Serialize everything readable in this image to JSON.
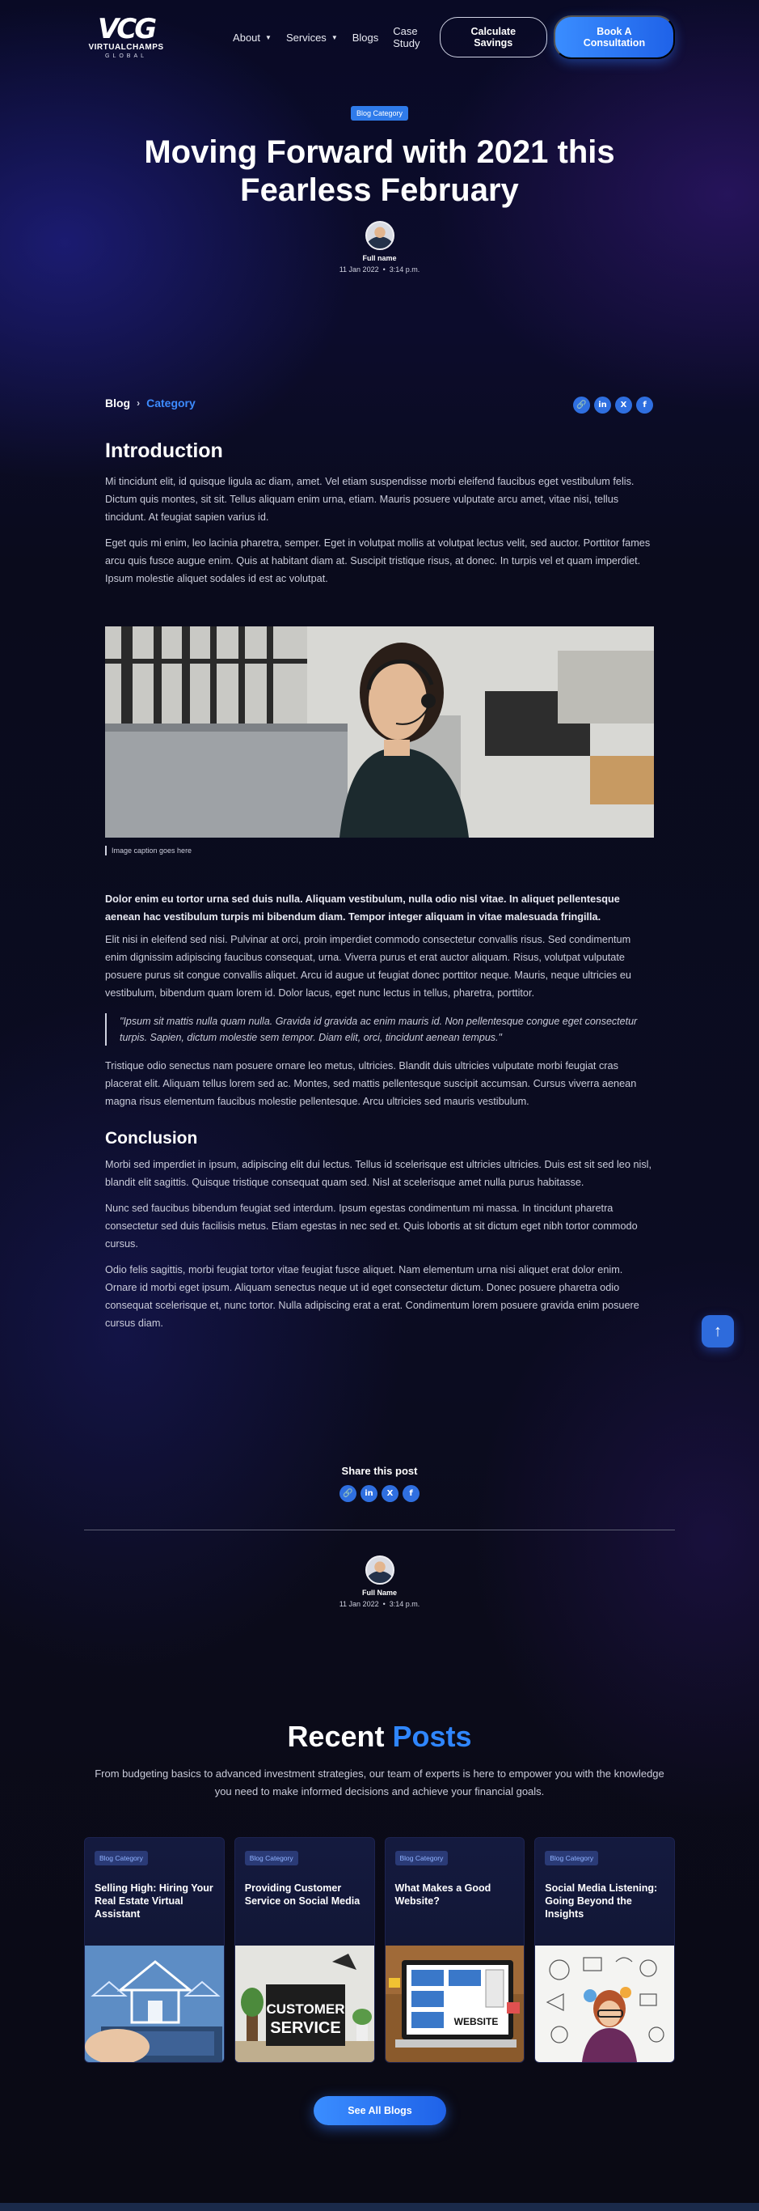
{
  "brand": {
    "logo_mark": "VCG",
    "name": "VIRTUALCHAMPS",
    "sub": "GLOBAL"
  },
  "nav": {
    "items": [
      {
        "label": "About",
        "has_menu": true
      },
      {
        "label": "Services",
        "has_menu": true
      },
      {
        "label": "Blogs",
        "has_menu": false
      },
      {
        "label": "Case Study",
        "has_menu": false
      }
    ],
    "calc_label": "Calculate Savings",
    "book_label": "Book A Consultation"
  },
  "hero": {
    "badge": "Blog Category",
    "title": "Moving Forward with 2021 this Fearless February",
    "author": "Full name",
    "date": "11 Jan 2022",
    "time": "3:14 p.m."
  },
  "breadcrumb": {
    "root": "Blog",
    "current": "Category"
  },
  "share_icons": [
    "link-icon",
    "linkedin-icon",
    "x-icon",
    "facebook-icon"
  ],
  "article": {
    "intro_heading": "Introduction",
    "intro_p1": "Mi tincidunt elit, id quisque ligula ac diam, amet. Vel etiam suspendisse morbi eleifend faucibus eget vestibulum felis. Dictum quis montes, sit sit. Tellus aliquam enim urna, etiam. Mauris posuere vulputate arcu amet, vitae nisi, tellus tincidunt. At feugiat sapien varius id.",
    "intro_p2": "Eget quis mi enim, leo lacinia pharetra, semper. Eget in volutpat mollis at volutpat lectus velit, sed auctor. Porttitor fames arcu quis fusce augue enim. Quis at habitant diam at. Suscipit tristique risus, at donec. In turpis vel et quam imperdiet. Ipsum molestie aliquet sodales id est ac volutpat.",
    "image_caption": "Image caption goes here",
    "lead": "Dolor enim eu tortor urna sed duis nulla. Aliquam vestibulum, nulla odio nisl vitae. In aliquet pellentesque aenean hac vestibulum turpis mi bibendum diam. Tempor integer aliquam in vitae malesuada fringilla.",
    "body_p1": "Elit nisi in eleifend sed nisi. Pulvinar at orci, proin imperdiet commodo consectetur convallis risus. Sed condimentum enim dignissim adipiscing faucibus consequat, urna. Viverra purus et erat auctor aliquam. Risus, volutpat vulputate posuere purus sit congue convallis aliquet. Arcu id augue ut feugiat donec porttitor neque. Mauris, neque ultricies eu vestibulum, bibendum quam lorem id. Dolor lacus, eget nunc lectus in tellus, pharetra, porttitor.",
    "quote": "\"Ipsum sit mattis nulla quam nulla. Gravida id gravida ac enim mauris id. Non pellentesque congue eget consectetur turpis. Sapien, dictum molestie sem tempor. Diam elit, orci, tincidunt aenean tempus.\"",
    "body_p2": "Tristique odio senectus nam posuere ornare leo metus, ultricies. Blandit duis ultricies vulputate morbi feugiat cras placerat elit. Aliquam tellus lorem sed ac. Montes, sed mattis pellentesque suscipit accumsan. Cursus viverra aenean magna risus elementum faucibus molestie pellentesque. Arcu ultricies sed mauris vestibulum.",
    "conclusion_heading": "Conclusion",
    "concl_p1": "Morbi sed imperdiet in ipsum, adipiscing elit dui lectus. Tellus id scelerisque est ultricies ultricies. Duis est sit sed leo nisl, blandit elit sagittis. Quisque tristique consequat quam sed. Nisl at scelerisque amet nulla purus habitasse.",
    "concl_p2": "Nunc sed faucibus bibendum feugiat sed interdum. Ipsum egestas condimentum mi massa. In tincidunt pharetra consectetur sed duis facilisis metus. Etiam egestas in nec sed et. Quis lobortis at sit dictum eget nibh tortor commodo cursus.",
    "concl_p3": "Odio felis sagittis, morbi feugiat tortor vitae feugiat fusce aliquet. Nam elementum urna nisi aliquet erat dolor enim. Ornare id morbi eget ipsum. Aliquam senectus neque ut id eget consectetur dictum. Donec posuere pharetra odio consequat scelerisque et, nunc tortor. Nulla adipiscing erat a erat. Condimentum lorem posuere gravida enim posuere cursus diam."
  },
  "share_section": {
    "title": "Share this post"
  },
  "author_footer": {
    "name": "Full Name",
    "date": "11 Jan 2022",
    "time": "3:14 p.m."
  },
  "recent": {
    "title_main": "Recent",
    "title_accent": "Posts",
    "description": "From budgeting basics to advanced investment strategies, our team of experts is here to empower you with the knowledge you need to make informed decisions and achieve your financial goals.",
    "cards": [
      {
        "badge": "Blog Category",
        "title": "Selling High: Hiring Your Real Estate Virtual Assistant"
      },
      {
        "badge": "Blog Category",
        "title": "Providing Customer Service on Social Media"
      },
      {
        "badge": "Blog Category",
        "title": "What Makes a Good Website?"
      },
      {
        "badge": "Blog Category",
        "title": "Social Media Listening: Going Beyond the Insights"
      }
    ],
    "card2_sign_line1": "CUSTOMER",
    "card2_sign_line2": "SERVICE",
    "card3_sign": "WEBSITE",
    "see_all_label": "See All Blogs"
  },
  "colors": {
    "accent": "#2f86ff",
    "button": "#2563eb",
    "background": "#0a0b1a"
  }
}
